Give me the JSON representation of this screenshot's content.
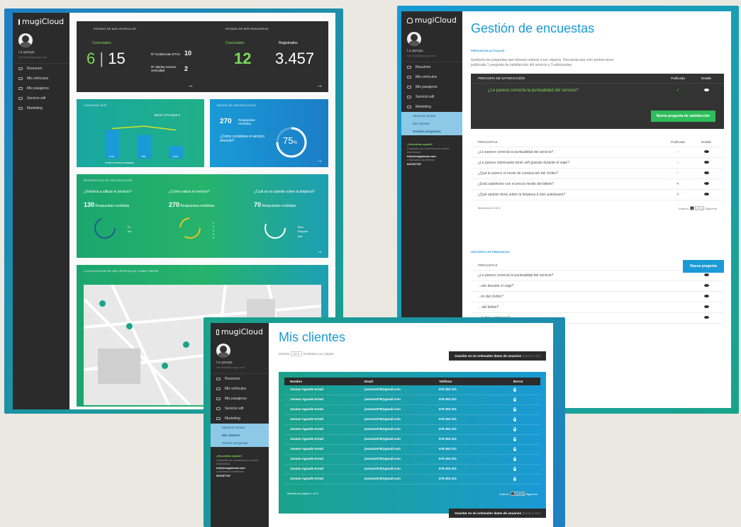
{
  "app": {
    "logo": "mugiCloud",
    "user": "La garaga",
    "email": "cuenta@lagaraga.com"
  },
  "nav": [
    "Resumen",
    "Mis vehículos",
    "Mis pasajeros",
    "Servicio wifi",
    "Marketing"
  ],
  "marketing_sub": [
    "Situación actual",
    "Mis clientes",
    "Gestión preguntas"
  ],
  "help": {
    "title": "¿Necesitas ayuda?",
    "text": "Contacta con nosotros por correo electrónico",
    "email": "info@mugicloud.com",
    "phone_text": "o llamando al teléfono",
    "phone": "943787787"
  },
  "dashboard": {
    "veh_title": "ESTADO DE MIS VEHÍCULOS",
    "pas_title": "ESTADO DE MIS PASAJEROS",
    "conectados": "Conectados",
    "registrados": "Registrados",
    "veh_conn": "6",
    "veh_total": "15",
    "incidencias_label": "Nº incidencias DTCs",
    "incidencias": "10",
    "alertas_label": "Nº alertas exceso velocidad",
    "alertas": "2",
    "pas_conn": "12",
    "pas_reg": "3.457",
    "consumo_title": "CONSUMO WIFI",
    "bus": "BUS1 HTC4532",
    "chart_legend": "Límite de tarifa contratada",
    "sat_title": "ÍNDICE DE SATISFACCIÓN",
    "sat_count": "270",
    "sat_count_label": "Respuestas recibidas",
    "sat_q": "¿Cómo considera el servicio ofrecido?",
    "sat_pct": "75",
    "resp_title": "RESPUESTAS DE SATISFACCIÓN",
    "survey": [
      {
        "q": "¿Volvería a utilizar el servicio?",
        "n": "130",
        "legend": [
          "Sí",
          "No"
        ]
      },
      {
        "q": "¿Cómo valora el servicio?",
        "n": "270",
        "legend": [
          "1",
          "2",
          "3",
          "4",
          "5"
        ]
      },
      {
        "q": "¿Cuál es su opinión sobre la limpieza?",
        "n": "70",
        "legend": [
          "Bien",
          "Regular",
          "Mal"
        ]
      }
    ],
    "resp_label": "Respuestas recibidas",
    "map_title": "LOCALIZACIÓN DE MIS VEHÍCULOS CONECTADOS"
  },
  "chart_data": {
    "type": "bar",
    "categories": [
      "ene.",
      "feb.",
      "mar."
    ],
    "values": [
      1800,
      1500,
      800
    ],
    "line": [
      1900,
      2050,
      1800
    ],
    "ylim": [
      0,
      2500
    ]
  },
  "encuestas": {
    "title": "Gestión de encuestas",
    "actuales": "PREGUNTAS ACTUALES",
    "intro1": "Gestiona las preguntas que deseas realizar a tus viajeros.",
    "intro2": "Recuerda que solo podrás tener publicada 1 pregunta de satisfacción del servicio y 3 adicionales.",
    "sat_head": "PREGUNTA DE SATISFACCIÓN",
    "publicada": "Publicada",
    "detalle": "Detalle",
    "sat_question": "¿Le parece correcta la puntualidad del servicio?",
    "new_sat_btn": "Nueva pregunta de satisfacción",
    "preguntas": "PREGUNTAS",
    "rows": [
      {
        "q": "¿Le parece correcta la puntualidad del servicio?",
        "s": "✓"
      },
      {
        "q": "¿Le parece interesante tener wifi gratuito durante el viaje?",
        "s": "✓"
      },
      {
        "q": "¿Qué le parece el modo de conducción del chófer?",
        "s": "✓"
      },
      {
        "q": "¿Está satisfecho con el precio medio del billete?",
        "s": "✕"
      },
      {
        "q": "¿Qué opinión tiene sobre la limpieza d elos autobuses?",
        "s": "✕"
      }
    ],
    "mostrando": "Mostrando 5 de 6",
    "anterior": "Anterior",
    "siguiente": "Siguiente",
    "new_btn": "Nueva pregunta",
    "historico": "HISTÓRICO DE PREGUNTAS",
    "hist_rows": [
      "¿Le parece correcta la puntualidad del servicio?",
      "...uito durante el viaje?",
      "...ón del chófer?",
      "... del billete?",
      "...d elos autobuses?"
    ]
  },
  "clientes": {
    "title": "Mis clientes",
    "mostrar": "Mostrar",
    "per_page": "10",
    "per_page_label": "resultados por página",
    "save_btn": "Guardar en mi ordenador datos de usuarios",
    "save_btn_ext": "(Excel o csv)",
    "cols": [
      "Nombre",
      "Email",
      "Teléfono",
      "Borrar"
    ],
    "rows": [
      [
        "Josean Agoado Ereati",
        "josean1978@gmail.com",
        "678 453 221"
      ],
      [
        "Josean Agoado Ereati",
        "josean1978@gmail.com",
        "678 453 221"
      ],
      [
        "Josean Agoado Ereati",
        "josean1978@gmail.com",
        "678 453 221"
      ],
      [
        "Josean Agoado Ereati",
        "josean1978@gmail.com",
        "678 453 221"
      ],
      [
        "Josean Agoado Ereati",
        "josean1978@gmail.com",
        "678 453 221"
      ],
      [
        "Josean Agoado Ereati",
        "josean1978@gmail.com",
        "678 453 221"
      ],
      [
        "Josean Agoado Ereati",
        "josean1978@gmail.com",
        "678 453 221"
      ],
      [
        "Josean Agoado Ereati",
        "josean1978@gmail.com",
        "678 453 221"
      ],
      [
        "Josean Agoado Ereati",
        "josean1978@gmail.com",
        "678 453 221"
      ],
      [
        "Josean Agoado Ereati",
        "josean1978@gmail.com",
        "678 453 221"
      ]
    ],
    "mostrando": "Mostrando página 1 de 3",
    "anterior": "Anterior",
    "siguiente": "Siguiente"
  },
  "pages": [
    "1",
    "2",
    "3"
  ]
}
